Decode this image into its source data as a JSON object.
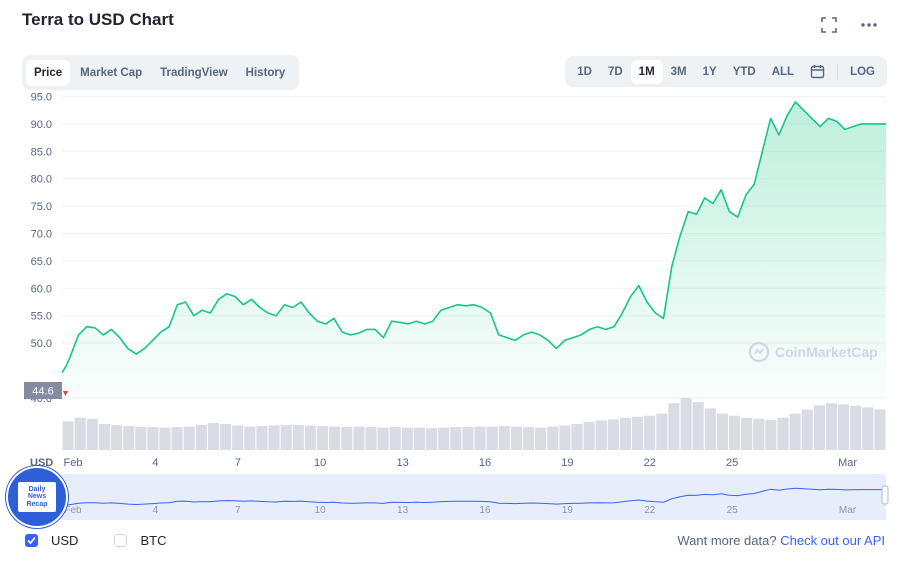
{
  "title": "Terra to USD Chart",
  "header_icons": [
    "fullscreen-icon",
    "more-icon"
  ],
  "tabs": [
    {
      "label": "Price",
      "active": true
    },
    {
      "label": "Market Cap",
      "active": false
    },
    {
      "label": "TradingView",
      "active": false
    },
    {
      "label": "History",
      "active": false
    }
  ],
  "ranges": [
    {
      "label": "1D",
      "active": false
    },
    {
      "label": "7D",
      "active": false
    },
    {
      "label": "1M",
      "active": true
    },
    {
      "label": "3M",
      "active": false
    },
    {
      "label": "1Y",
      "active": false
    },
    {
      "label": "YTD",
      "active": false
    },
    {
      "label": "ALL",
      "active": false
    }
  ],
  "log_label": "LOG",
  "watermark": "CoinMarketCap",
  "price_marker": "44.6",
  "currency_axis_label": "USD",
  "colors": {
    "line": "#16c784",
    "fill": "#16c784",
    "volume": "#d9dce3",
    "accent": "#3861fb",
    "marker": "#858ca2",
    "start_triangle": "#ea3943"
  },
  "bottom": {
    "checkboxes": [
      {
        "label": "USD",
        "checked": true
      },
      {
        "label": "BTC",
        "checked": false
      }
    ],
    "more_text": "Want more data?",
    "more_link": "Check out our API"
  },
  "badge_text": [
    "Daily",
    "News",
    "Recap"
  ],
  "chart_data": {
    "type": "line",
    "title": "Terra to USD Chart",
    "ylabel": "USD",
    "yticks": [
      "95.0",
      "90.0",
      "85.0",
      "80.0",
      "75.0",
      "70.0",
      "65.0",
      "60.0",
      "55.0",
      "50.0",
      "40.0"
    ],
    "ylim": [
      38,
      97
    ],
    "xlim": [
      0,
      30
    ],
    "xticks": [
      {
        "label": "Feb",
        "x": 0.4
      },
      {
        "label": "4",
        "x": 3.4
      },
      {
        "label": "7",
        "x": 6.4
      },
      {
        "label": "10",
        "x": 9.4
      },
      {
        "label": "13",
        "x": 12.4
      },
      {
        "label": "16",
        "x": 15.4
      },
      {
        "label": "19",
        "x": 18.4
      },
      {
        "label": "22",
        "x": 21.4
      },
      {
        "label": "25",
        "x": 24.4
      },
      {
        "label": "Mar",
        "x": 28.6
      }
    ],
    "series": [
      {
        "x": [
          0,
          0.15,
          0.3,
          0.6,
          0.9,
          1.2,
          1.5,
          1.8,
          2.1,
          2.4,
          2.7,
          3.0,
          3.3,
          3.6,
          3.9,
          4.2,
          4.5,
          4.8,
          5.1,
          5.4,
          5.7,
          6.0,
          6.3,
          6.6,
          6.9,
          7.2,
          7.5,
          7.8,
          8.1,
          8.4,
          8.7,
          9.0,
          9.3,
          9.6,
          9.9,
          10.2,
          10.5,
          10.8,
          11.1,
          11.4,
          11.7,
          12.0,
          12.3,
          12.6,
          12.9,
          13.2,
          13.5,
          13.8,
          14.1,
          14.4,
          14.7,
          15.0,
          15.3,
          15.6,
          15.9,
          16.2,
          16.5,
          16.8,
          17.1,
          17.4,
          17.7,
          18.0,
          18.3,
          18.6,
          18.9,
          19.2,
          19.5,
          19.8,
          20.1,
          20.4,
          20.7,
          21.0,
          21.3,
          21.6,
          21.9,
          22.2,
          22.5,
          22.8,
          23.1,
          23.4,
          23.7,
          24.0,
          24.3,
          24.6,
          24.9,
          25.2,
          25.5,
          25.8,
          26.1,
          26.4,
          26.7,
          27.0,
          27.3,
          27.6,
          27.9,
          28.2,
          28.5,
          28.8,
          29.1,
          29.4,
          29.7,
          30.0
        ],
        "values": [
          44.6,
          45.8,
          47.5,
          51.5,
          53.0,
          52.8,
          51.5,
          52.5,
          51.0,
          49.0,
          48.0,
          49.0,
          50.5,
          52.0,
          53.0,
          57.0,
          57.5,
          55.0,
          56.0,
          55.5,
          58.0,
          59.0,
          58.5,
          57.0,
          58.0,
          56.5,
          55.5,
          55.0,
          57.0,
          56.5,
          57.5,
          55.5,
          54.0,
          53.5,
          54.5,
          52.0,
          51.5,
          51.8,
          52.5,
          52.5,
          51.0,
          54.0,
          53.8,
          53.5,
          54.0,
          53.5,
          54.0,
          56.0,
          56.5,
          57.0,
          56.8,
          57.0,
          56.5,
          55.5,
          51.5,
          51.0,
          50.5,
          51.5,
          52.0,
          51.5,
          50.5,
          49.0,
          50.5,
          51.0,
          51.5,
          52.5,
          53.0,
          52.5,
          53.0,
          55.5,
          58.5,
          60.5,
          57.5,
          55.5,
          54.5,
          64.0,
          69.5,
          74.0,
          73.5,
          76.5,
          75.5,
          78.0,
          74.0,
          73.0,
          77.0,
          79.0,
          85.0,
          91.0,
          88.0,
          91.5,
          94.0,
          92.5,
          91.0,
          89.5,
          91.0,
          90.5,
          89.0,
          89.5,
          90.0,
          90.0,
          90.0,
          90.0
        ]
      }
    ],
    "volume": [
      0.55,
      0.62,
      0.6,
      0.5,
      0.48,
      0.46,
      0.44,
      0.44,
      0.43,
      0.44,
      0.45,
      0.48,
      0.52,
      0.5,
      0.47,
      0.45,
      0.46,
      0.47,
      0.48,
      0.48,
      0.47,
      0.46,
      0.45,
      0.44,
      0.45,
      0.44,
      0.43,
      0.44,
      0.43,
      0.43,
      0.42,
      0.43,
      0.44,
      0.44,
      0.45,
      0.45,
      0.46,
      0.45,
      0.44,
      0.43,
      0.45,
      0.47,
      0.5,
      0.54,
      0.57,
      0.59,
      0.62,
      0.64,
      0.66,
      0.7,
      0.9,
      1.0,
      0.92,
      0.8,
      0.7,
      0.66,
      0.62,
      0.6,
      0.58,
      0.62,
      0.7,
      0.78,
      0.86,
      0.9,
      0.88,
      0.85,
      0.82,
      0.78
    ],
    "navigator_xticks": [
      "Feb",
      "4",
      "7",
      "10",
      "13",
      "16",
      "19",
      "22",
      "25",
      "Mar"
    ]
  }
}
